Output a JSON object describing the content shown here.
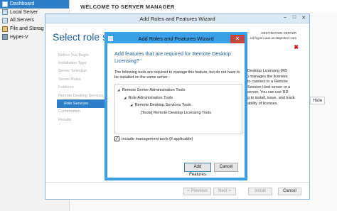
{
  "sidebar": {
    "items": [
      {
        "label": "Dashboard",
        "icon": "dashboard-icon",
        "selected": true
      },
      {
        "label": "Local Server",
        "icon": "server-icon",
        "selected": false
      },
      {
        "label": "All Servers",
        "icon": "servers-icon",
        "selected": false
      },
      {
        "label": "File and Storag",
        "icon": "storage-icon",
        "selected": false
      },
      {
        "label": "Hyper-V",
        "icon": "hyperv-icon",
        "selected": false
      }
    ]
  },
  "header": {
    "title": "WELCOME TO SERVER MANAGER"
  },
  "main": {
    "hide_label": "Hide"
  },
  "wizard": {
    "title": "Add Roles and Features Wizard",
    "page_title": "Select role servi",
    "destination_label": "DESTINATION SERVER",
    "destination_server": "...nd-hyperv.aus.us.steprotect.com",
    "steps": [
      "Before You Begin",
      "Installation Type",
      "Server Selection",
      "Server Roles",
      "Features",
      "Remote Desktop Services",
      "Role Services",
      "Confirmation",
      "Results"
    ],
    "selected_step": "Role Services",
    "right_text": [
      "Desktop Licensing (RD",
      ") manages the licenses",
      "to connect to a Remote",
      "Session Host server or a",
      "server. You can use RD",
      "g to install, issue, and track",
      "ability of licenses."
    ],
    "buttons": {
      "prev": "< Previous",
      "next": "Next >",
      "install": "Install",
      "cancel": "Cancel"
    }
  },
  "dialog": {
    "title": "Add Roles and Features Wizard",
    "heading": "Add features that are required for Remote Desktop Licensing?",
    "description": "The following tools are required to manage this feature, but do not have to be installed on the same server.",
    "tree": [
      {
        "label": "Remote Server Administration Tools",
        "level": 0,
        "arrow": true
      },
      {
        "label": "Role Administration Tools",
        "level": 1,
        "arrow": true
      },
      {
        "label": "Remote Desktop Services Tools",
        "level": 2,
        "arrow": true
      },
      {
        "label": "[Tools] Remote Desktop Licensing Tools",
        "level": 3,
        "arrow": false
      }
    ],
    "include_tools_label": "Include management tools (if applicable)",
    "include_tools_checked": true,
    "add_button": "Add Features",
    "cancel_button": "Cancel"
  },
  "colors": {
    "accent": "#2e7fc8",
    "dialog_border": "#3aa0e8",
    "close_red": "#c7463a",
    "heading_blue": "#1b5c9a"
  }
}
